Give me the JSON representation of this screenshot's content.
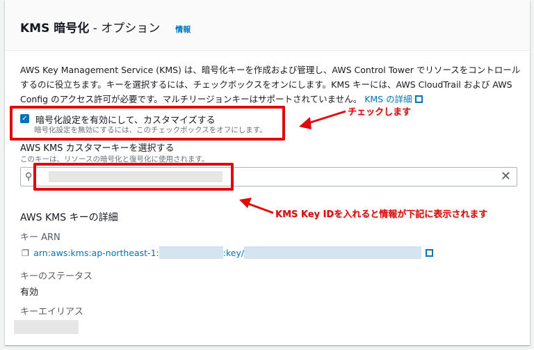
{
  "header": {
    "title_bold": "KMS 暗号化",
    "title_rest": " - オプション",
    "info_link": "情報"
  },
  "description": {
    "text": "AWS Key Management Service (KMS) は、暗号化キーを作成および管理し、AWS Control Tower でリソースをコントロールするのに役立ちます。キーを選択するには、チェックボックスをオンにします。KMS キーには、AWS CloudTrail および AWS Config のアクセス許可が必要です。マルチリージョンキーはサポートされていません。",
    "link": "KMS の詳細"
  },
  "checkbox": {
    "label": "暗号化設定を有効にして、カスタマイズする",
    "description": "暗号化設定を無効にするには、このチェックボックスをオフにします。",
    "checked": true
  },
  "key_select": {
    "label": "AWS KMS カスタマーキーを選択する",
    "description": "このキーは、リソースの暗号化と復号化に使用されます。"
  },
  "details": {
    "title": "AWS KMS キーの詳細",
    "arn_label": "キー ARN",
    "arn_prefix": "arn:aws:kms:ap-northeast-1:",
    "arn_mid": ":key/",
    "status_label": "キーのステータス",
    "status_value": "有効",
    "alias_label": "キーエイリアス"
  },
  "annotations": {
    "check": "チェックします",
    "key_id": "KMS Key IDを入れると情報が下記に表示されます"
  },
  "colors": {
    "accent": "#0073bb",
    "annotation": "#e10a0a"
  }
}
